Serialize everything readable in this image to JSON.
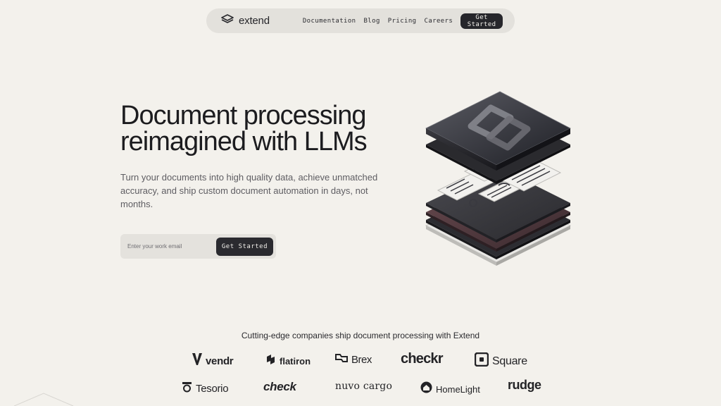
{
  "nav": {
    "brand": "extend",
    "links": [
      "Documentation",
      "Blog",
      "Pricing",
      "Careers"
    ],
    "cta": "Get Started"
  },
  "hero": {
    "title_line1": "Document processing",
    "title_line2": "reimagined with LLMs",
    "subtitle": "Turn your documents into high quality data, achieve unmatched accuracy, and ship custom document automation in days, not months.",
    "email_placeholder": "Enter your work email",
    "cta": "Get Started"
  },
  "logos": {
    "caption": "Cutting-edge companies ship document processing with Extend",
    "row1": [
      "vendr",
      "flatiron",
      "Brex",
      "checkr",
      "Square"
    ],
    "row2": [
      "Tesorio",
      "check",
      "nuvo cargo",
      "HomeLight",
      "rudge"
    ]
  },
  "colors": {
    "background": "#f3f1ec",
    "nav_pill": "#e3e1dc",
    "button_dark": "#26262b",
    "text_primary": "#1c1c1f",
    "text_muted": "#5e5d62"
  }
}
